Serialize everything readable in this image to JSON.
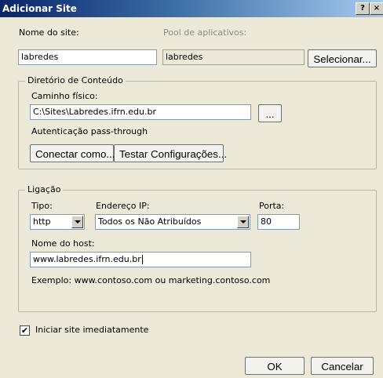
{
  "window": {
    "title": "Adicionar Site",
    "help_label": "?",
    "close_label": "×"
  },
  "site": {
    "name_label": "Nome do site:",
    "name_value": "labredes",
    "pool_label": "Pool de aplicativos:",
    "pool_value": "labredes",
    "select_button": "Selecionar..."
  },
  "content_dir": {
    "legend": "Diretório de Conteúdo",
    "physical_path_label": "Caminho físico:",
    "physical_path_value": "C:\\Sites\\Labredes.ifrn.edu.br",
    "browse_button": "...",
    "auth_text": "Autenticação pass-through",
    "connect_as_button": "Conectar como...",
    "test_settings_button": "Testar Configurações..."
  },
  "binding": {
    "legend": "Ligação",
    "type_label": "Tipo:",
    "type_value": "http",
    "ip_label": "Endereço IP:",
    "ip_value": "Todos os Não Atribuídos",
    "port_label": "Porta:",
    "port_value": "80",
    "host_label": "Nome do host:",
    "host_value": "www.labredes.ifrn.edu.br",
    "example_text": "Exemplo: www.contoso.com ou marketing.contoso.com"
  },
  "start": {
    "label": "Iniciar site imediatamente",
    "checked": true
  },
  "footer": {
    "ok_button": "OK",
    "cancel_button": "Cancelar"
  }
}
